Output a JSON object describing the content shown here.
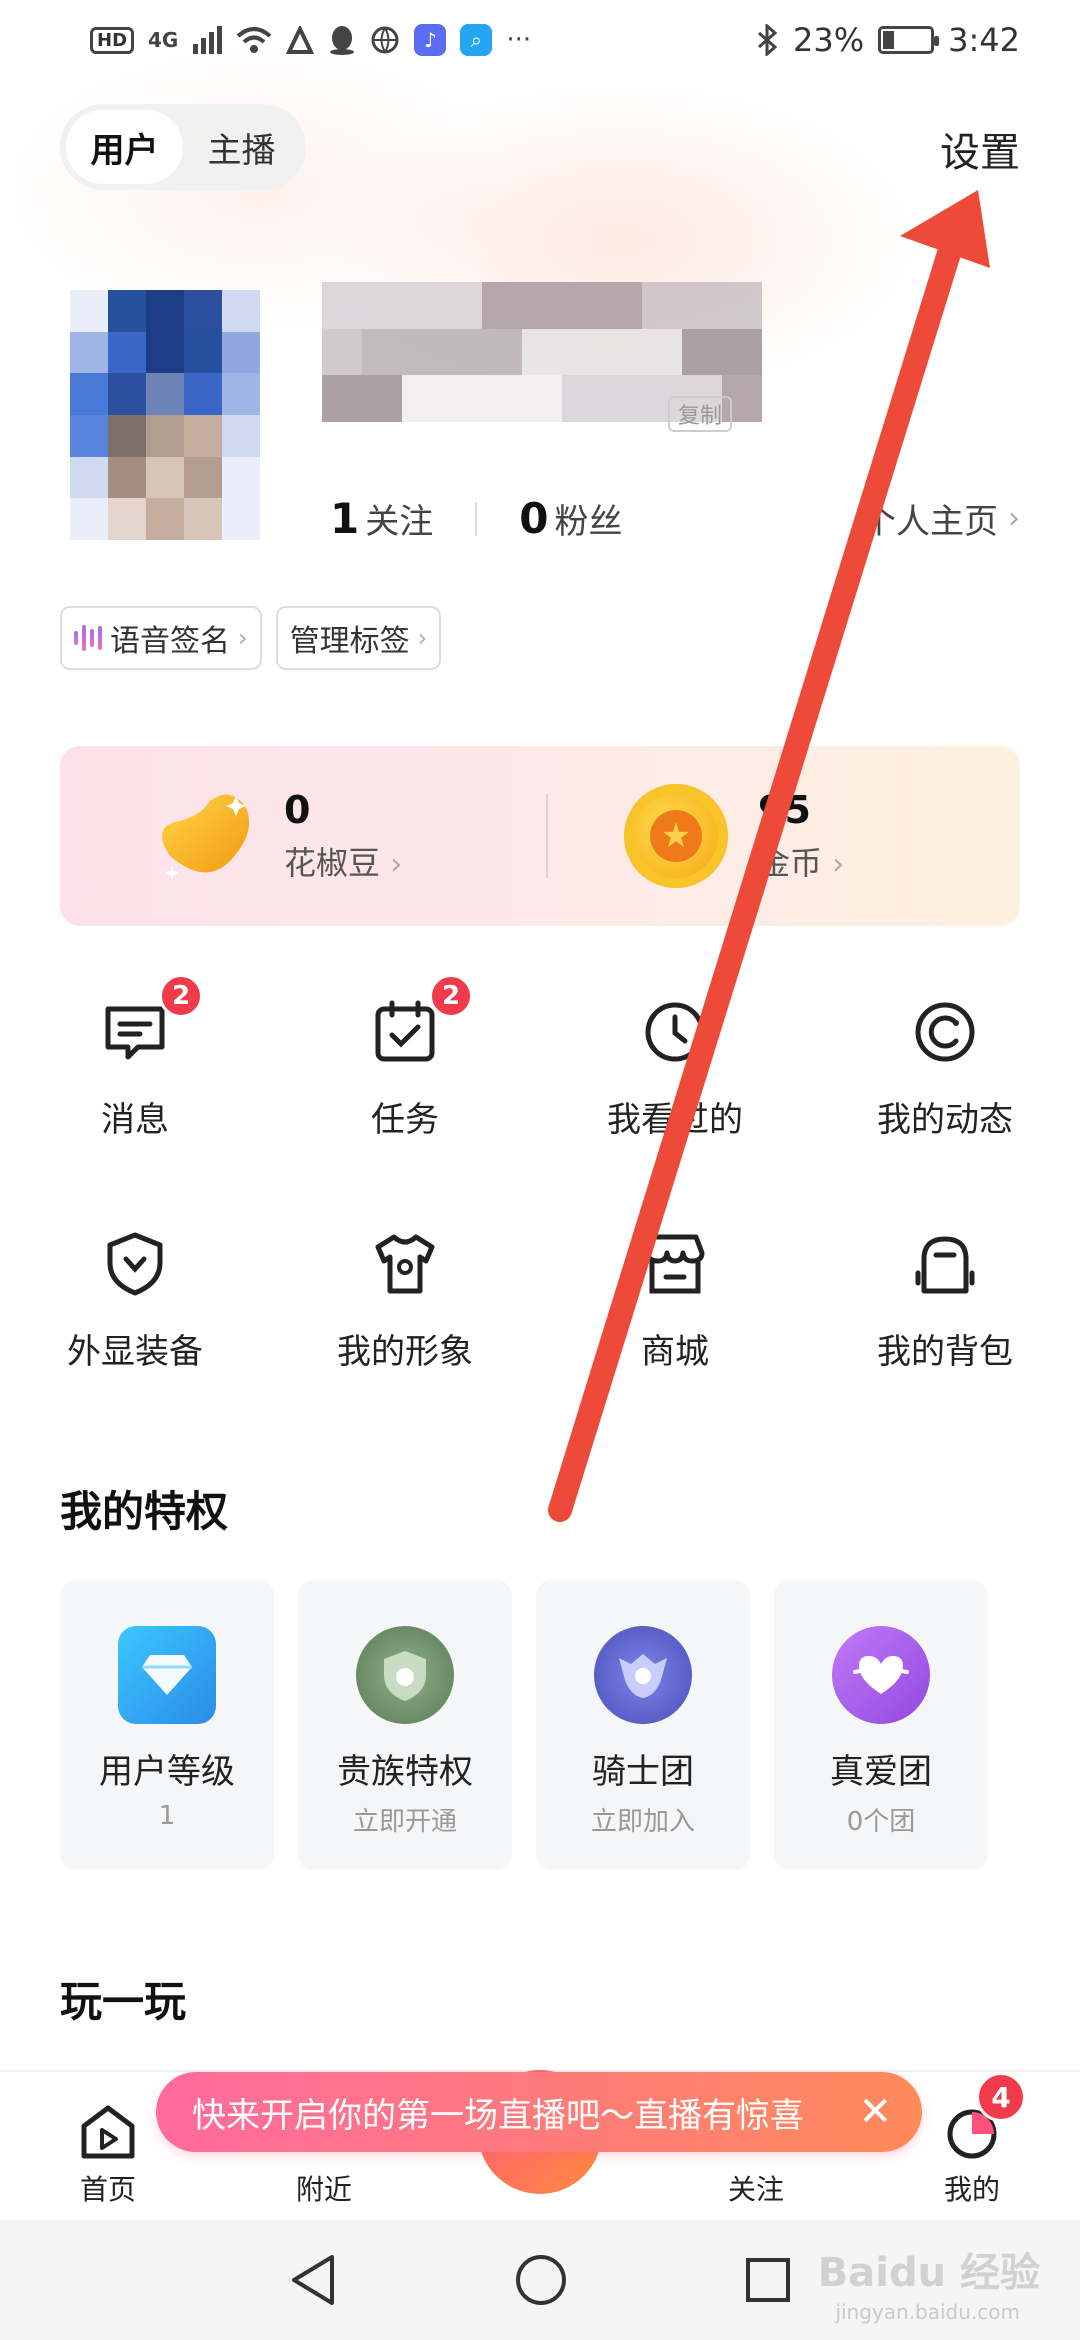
{
  "status_bar": {
    "network": "4G",
    "hd": "HD",
    "more": "···",
    "battery": "23%",
    "battery_level": 0.23,
    "time": "3:42"
  },
  "header": {
    "tabs": [
      "用户",
      "主播"
    ],
    "active_tab": "用户",
    "settings": "设置"
  },
  "profile": {
    "following_count": "1",
    "following_label": "关注",
    "fans_count": "0",
    "fans_label": "粉丝",
    "home_link": "个人主页",
    "copy": "复制",
    "tags": [
      "语音签名",
      "管理标签"
    ]
  },
  "wallet": {
    "beans_count": "0",
    "beans_label": "花椒豆",
    "coins_count": "95",
    "coins_label": "金币"
  },
  "menu": [
    {
      "label": "消息",
      "badge": "2",
      "icon": "message-icon"
    },
    {
      "label": "任务",
      "badge": "2",
      "icon": "task-icon"
    },
    {
      "label": "我看过的",
      "icon": "clock-icon"
    },
    {
      "label": "我的动态",
      "icon": "dynamic-icon"
    },
    {
      "label": "外显装备",
      "icon": "shield-icon"
    },
    {
      "label": "我的形象",
      "icon": "shirt-icon"
    },
    {
      "label": "商城",
      "icon": "store-icon"
    },
    {
      "label": "我的背包",
      "icon": "backpack-icon"
    }
  ],
  "privileges": {
    "title": "我的特权",
    "items": [
      {
        "title": "用户等级",
        "sub": "1",
        "icon": "diamond-icon",
        "color": "#2fa8f0"
      },
      {
        "title": "贵族特权",
        "sub": "立即开通",
        "icon": "noble-shield-icon",
        "color": "#6f8f6a"
      },
      {
        "title": "骑士团",
        "sub": "立即加入",
        "icon": "knight-icon",
        "color": "#6a6fd0"
      },
      {
        "title": "真爱团",
        "sub": "0个团",
        "icon": "heart-icon",
        "color": "#a45ae8"
      }
    ]
  },
  "play": {
    "title": "玩一玩"
  },
  "bottom_nav": {
    "items": [
      "首页",
      "附近",
      "关注",
      "我的"
    ],
    "mine_badge": "4",
    "live_banner": "快来开启你的第一场直播吧～直播有惊喜"
  },
  "watermark": {
    "brand": "Baidu 经验",
    "url": "jingyan.baidu.com"
  },
  "colors": {
    "accent": "#f23b4a",
    "banner_start": "#ff6a9e",
    "banner_end": "#ff8a5a",
    "arrow": "#ee4a3a"
  }
}
